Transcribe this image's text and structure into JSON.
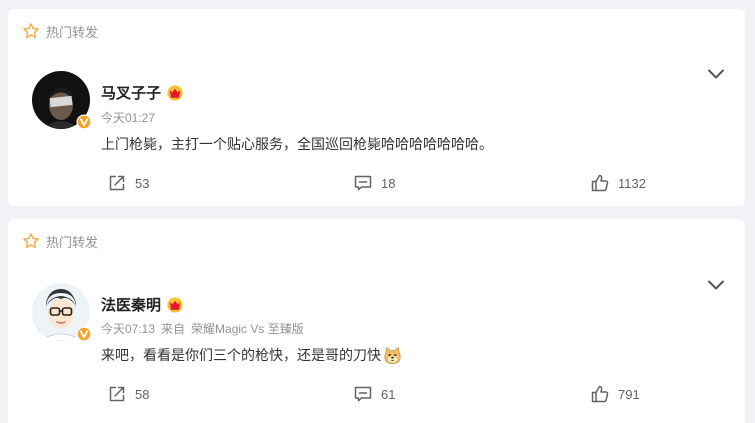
{
  "colors": {
    "accent": "#ff8200",
    "vip_red": "#e6162d",
    "background": "#f1f2f5",
    "card": "#ffffff"
  },
  "posts": [
    {
      "section_label": "热门转发",
      "author": "马叉子子",
      "timestamp": "今天01:27",
      "source_prefix": "",
      "source": "",
      "text": "上门枪毙，主打一个贴心服务，全国巡回枪毙哈哈哈哈哈哈哈。",
      "emoji": "",
      "reposts": "53",
      "comments": "18",
      "likes": "1132",
      "icons": {
        "section": "star-icon",
        "badge": "verified-badge-icon",
        "vip": "crown-icon",
        "menu": "chevron-down-icon",
        "repost": "share-icon",
        "comment": "comment-icon",
        "like": "thumbs-up-icon"
      }
    },
    {
      "section_label": "热门转发",
      "author": "法医秦明",
      "timestamp": "今天07:13",
      "source_prefix": "来自",
      "source": "荣耀Magic Vs 至臻版",
      "text": "来吧，看看是你们三个的枪快，还是哥的刀快",
      "emoji": "doge-emoji",
      "reposts": "58",
      "comments": "61",
      "likes": "791",
      "icons": {
        "section": "star-icon",
        "badge": "verified-badge-icon",
        "vip": "crown-icon",
        "menu": "chevron-down-icon",
        "repost": "share-icon",
        "comment": "comment-icon",
        "like": "thumbs-up-icon"
      }
    }
  ]
}
